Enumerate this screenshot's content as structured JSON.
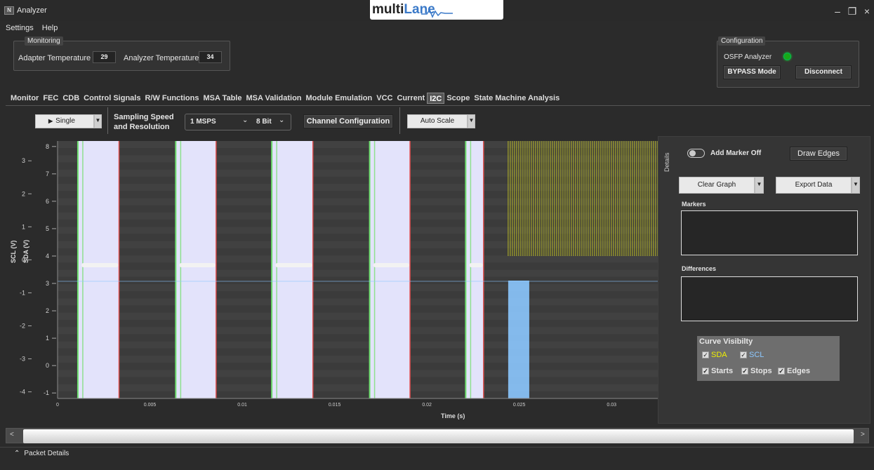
{
  "window": {
    "title": "Analyzer",
    "brand_prefix": "multi",
    "brand_suffix": "Lane",
    "minimize": "–",
    "restore": "❐",
    "close": "×"
  },
  "menu": [
    "Settings",
    "Help"
  ],
  "monitoring": {
    "label": "Monitoring",
    "adapter_label": "Adapter Temperature",
    "adapter_value": "29",
    "analyzer_label": "Analyzer Temperature",
    "analyzer_value": "34"
  },
  "configuration": {
    "label": "Configuration",
    "device": "OSFP Analyzer",
    "status_color": "#18a818",
    "bypass": "BYPASS Mode",
    "disconnect": "Disconnect"
  },
  "tabs": [
    "Monitor",
    "FEC",
    "CDB",
    "Control Signals",
    "R/W Functions",
    "MSA Table",
    "MSA Validation",
    "Module Emulation",
    "VCC",
    "Current",
    "I2C",
    "Scope",
    "State Machine Analysis"
  ],
  "active_tab": "I2C",
  "toolbar": {
    "run_mode": "Single",
    "sampling_label_1": "Sampling Speed",
    "sampling_label_2": "and Resolution",
    "speed": "1 MSPS",
    "resolution": "8 Bit",
    "channel_config": "Channel Configuration",
    "auto_scale": "Auto Scale"
  },
  "chart_data": {
    "type": "line",
    "xlabel": "Time (s)",
    "x_ticks": [
      "0",
      "0.005",
      "0.01",
      "0.015",
      "0.02",
      "0.025",
      "0.03"
    ],
    "xlim": [
      0,
      0.0325
    ],
    "scl_axis": {
      "label": "SCL (V)",
      "ticks": [
        "3",
        "2",
        "1",
        "0",
        "-1",
        "-2",
        "-3",
        "-4"
      ],
      "ylim": [
        -4.2,
        3.6
      ]
    },
    "sda_axis": {
      "label": "SDA (V)",
      "ticks": [
        "8",
        "7",
        "6",
        "5",
        "4",
        "3",
        "2",
        "1",
        "0",
        "-1"
      ],
      "ylim": [
        -1.2,
        8.2
      ]
    },
    "series": [
      {
        "name": "SDA",
        "color": "#e6e61e"
      },
      {
        "name": "SCL",
        "color": "#8cc8ff"
      }
    ],
    "packets": [
      {
        "start": 0.0011,
        "stop": 0.0064
      },
      {
        "start": 0.0064,
        "stop": 0.0116
      },
      {
        "start": 0.0116,
        "stop": 0.0169
      },
      {
        "start": 0.0169,
        "stop": 0.0221
      },
      {
        "start": 0.0221,
        "stop": 0.0244
      }
    ]
  },
  "details": {
    "tab_label": "Details",
    "marker_toggle": "Add Marker Off",
    "draw_edges": "Draw Edges",
    "clear_graph": "Clear Graph",
    "export_data": "Export Data",
    "markers_label": "Markers",
    "differences_label": "Differences",
    "curve_visibility": "Curve Visibilty",
    "sda": "SDA",
    "scl": "SCL",
    "starts": "Starts",
    "stops": "Stops",
    "edges": "Edges"
  },
  "scroll": {
    "left": "<",
    "right": ">"
  },
  "packet_details": {
    "expand": "⌃",
    "label": "Packet Details"
  }
}
